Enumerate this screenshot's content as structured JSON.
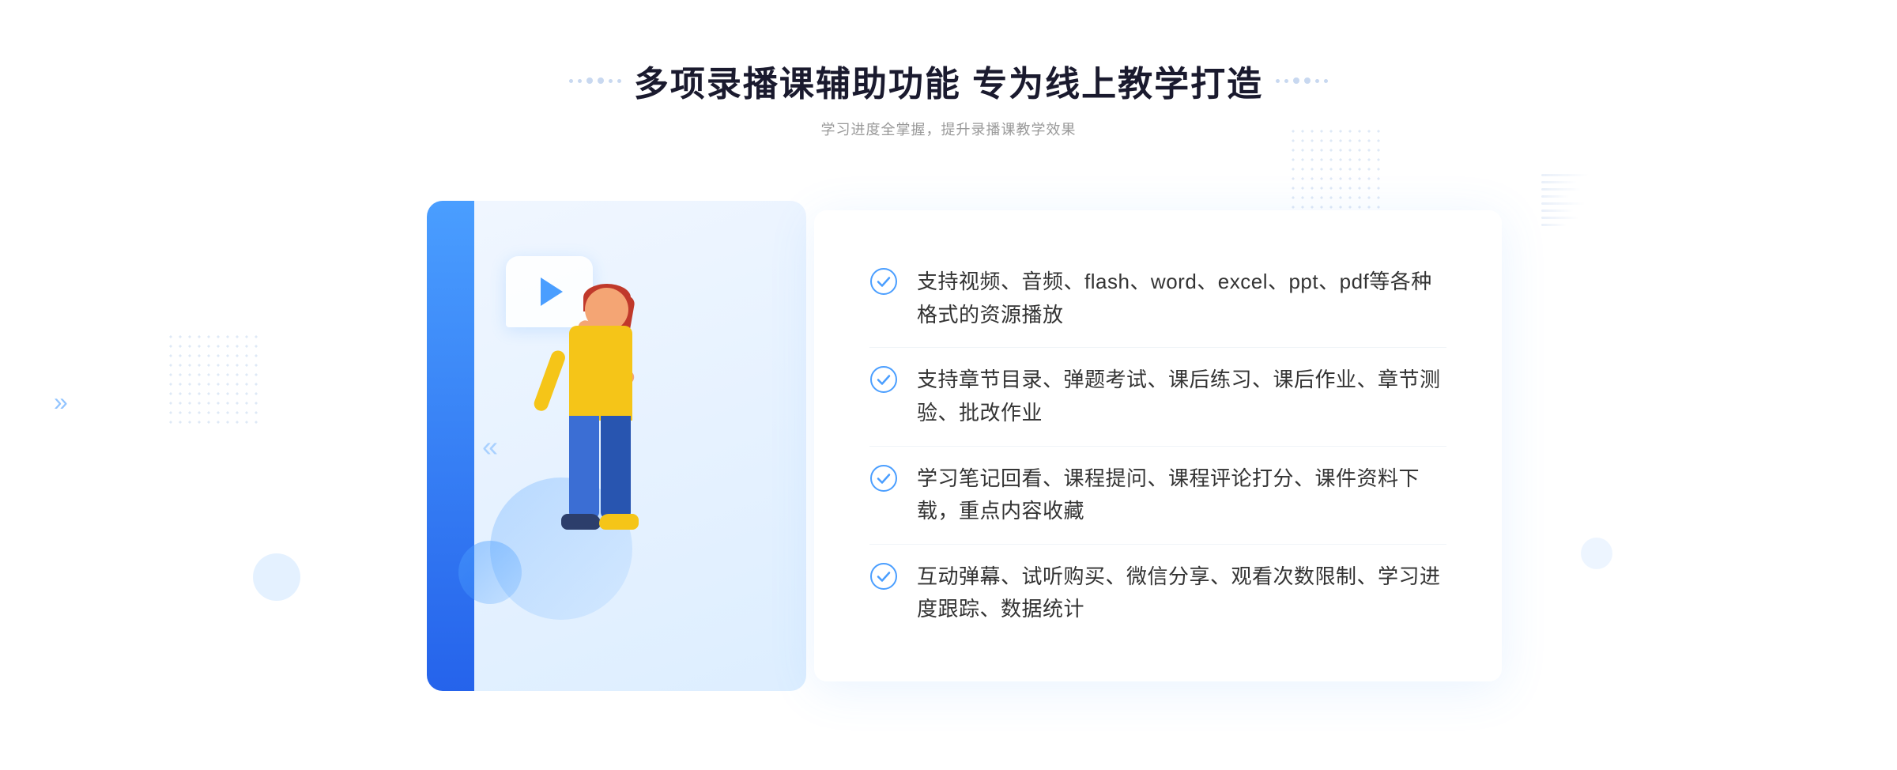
{
  "page": {
    "background": "#ffffff"
  },
  "header": {
    "main_title": "多项录播课辅助功能 专为线上教学打造",
    "sub_title": "学习进度全掌握，提升录播课教学效果"
  },
  "features": [
    {
      "id": 1,
      "text": "支持视频、音频、flash、word、excel、ppt、pdf等各种格式的资源播放"
    },
    {
      "id": 2,
      "text": "支持章节目录、弹题考试、课后练习、课后作业、章节测验、批改作业"
    },
    {
      "id": 3,
      "text": "学习笔记回看、课程提问、课程评论打分、课件资料下载，重点内容收藏"
    },
    {
      "id": 4,
      "text": "互动弹幕、试听购买、微信分享、观看次数限制、学习进度跟踪、数据统计"
    }
  ],
  "icons": {
    "check_circle": "check-circle-icon",
    "play": "play-icon",
    "chevron_left": "chevron-left-icon",
    "title_dots": "title-decoration-dots"
  },
  "colors": {
    "primary": "#4a9eff",
    "primary_dark": "#2563eb",
    "title": "#1a1a2e",
    "text": "#333333",
    "subtitle": "#999999",
    "check": "#4a9eff",
    "border": "#f0f4f8"
  }
}
